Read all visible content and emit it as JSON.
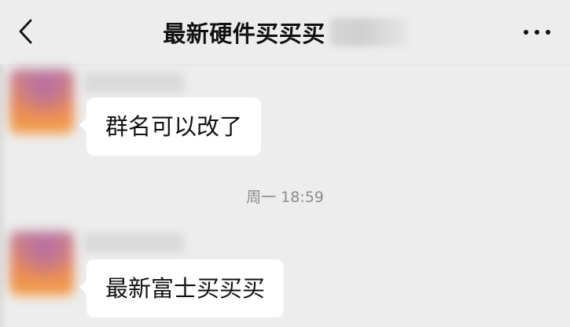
{
  "header": {
    "title": "最新硬件买买买",
    "back_icon": "chevron-left-icon",
    "more_icon": "ellipsis-icon"
  },
  "messages": [
    {
      "text": "群名可以改了"
    },
    {
      "text": "最新富士买买买"
    }
  ],
  "timestamp": "周一 18:59"
}
